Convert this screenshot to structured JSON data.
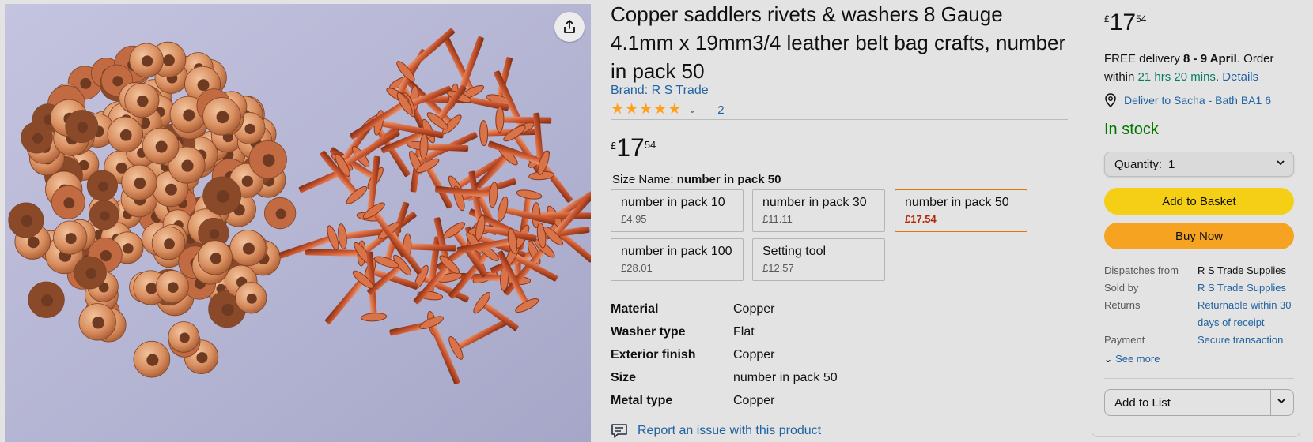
{
  "product": {
    "title": "Copper saddlers rivets & washers 8 Gauge 4.1mm x 19mm3/4 leather belt bag crafts, number in pack 50",
    "brand": "Brand: R S Trade",
    "rating": {
      "stars": 5,
      "review_count": "2"
    },
    "price": {
      "currency": "£",
      "whole": "17",
      "fraction": "54"
    },
    "size_name_label": "Size Name:",
    "size_name_value": "number in pack 50",
    "sizes": [
      {
        "label": "number in pack 10",
        "price": "£4.95",
        "selected": false
      },
      {
        "label": "number in pack 30",
        "price": "£11.11",
        "selected": false
      },
      {
        "label": "number in pack 50",
        "price": "£17.54",
        "selected": true
      },
      {
        "label": "number in pack 100",
        "price": "£28.01",
        "selected": false
      },
      {
        "label": "Setting tool",
        "price": "£12.57",
        "selected": false
      }
    ],
    "specs": [
      {
        "key": "Material",
        "value": "Copper"
      },
      {
        "key": "Washer type",
        "value": "Flat"
      },
      {
        "key": "Exterior finish",
        "value": "Copper"
      },
      {
        "key": "Size",
        "value": "number in pack 50"
      },
      {
        "key": "Metal type",
        "value": "Copper"
      }
    ],
    "report_issue": "Report an issue with this product"
  },
  "buybox": {
    "price": {
      "currency": "£",
      "whole": "17",
      "fraction": "54"
    },
    "delivery_prefix": "FREE delivery ",
    "delivery_dates": "8 - 9 April",
    "order_within_prefix": ". Order within ",
    "order_within_time": "21 hrs 20 mins",
    "details_link": "Details",
    "deliver_to": "Deliver to Sacha - Bath BA1 6",
    "stock_status": "In stock",
    "quantity_label": "Quantity:",
    "quantity_value": "1",
    "add_to_basket": "Add to Basket",
    "buy_now": "Buy Now",
    "meta": {
      "dispatches_from_label": "Dispatches from",
      "dispatches_from_value": "R S Trade Supplies",
      "sold_by_label": "Sold by",
      "sold_by_value": "R S Trade Supplies",
      "returns_label": "Returns",
      "returns_value": "Returnable within 30 days of receipt",
      "payment_label": "Payment",
      "payment_value": "Secure transaction"
    },
    "see_more": "See more",
    "add_to_list": "Add to List"
  },
  "colors": {
    "link": "#2162a1",
    "in_stock": "#007600",
    "deal_price": "#b12704",
    "basket_button": "#f5cf16",
    "buy_button": "#f5a320",
    "selected_swatch_border": "#e77600",
    "star": "#ff9f1a"
  },
  "icons": {
    "share": "share-icon",
    "location": "location-pin-icon",
    "report": "speech-bubble-icon",
    "chevron": "chevron-down-icon"
  }
}
